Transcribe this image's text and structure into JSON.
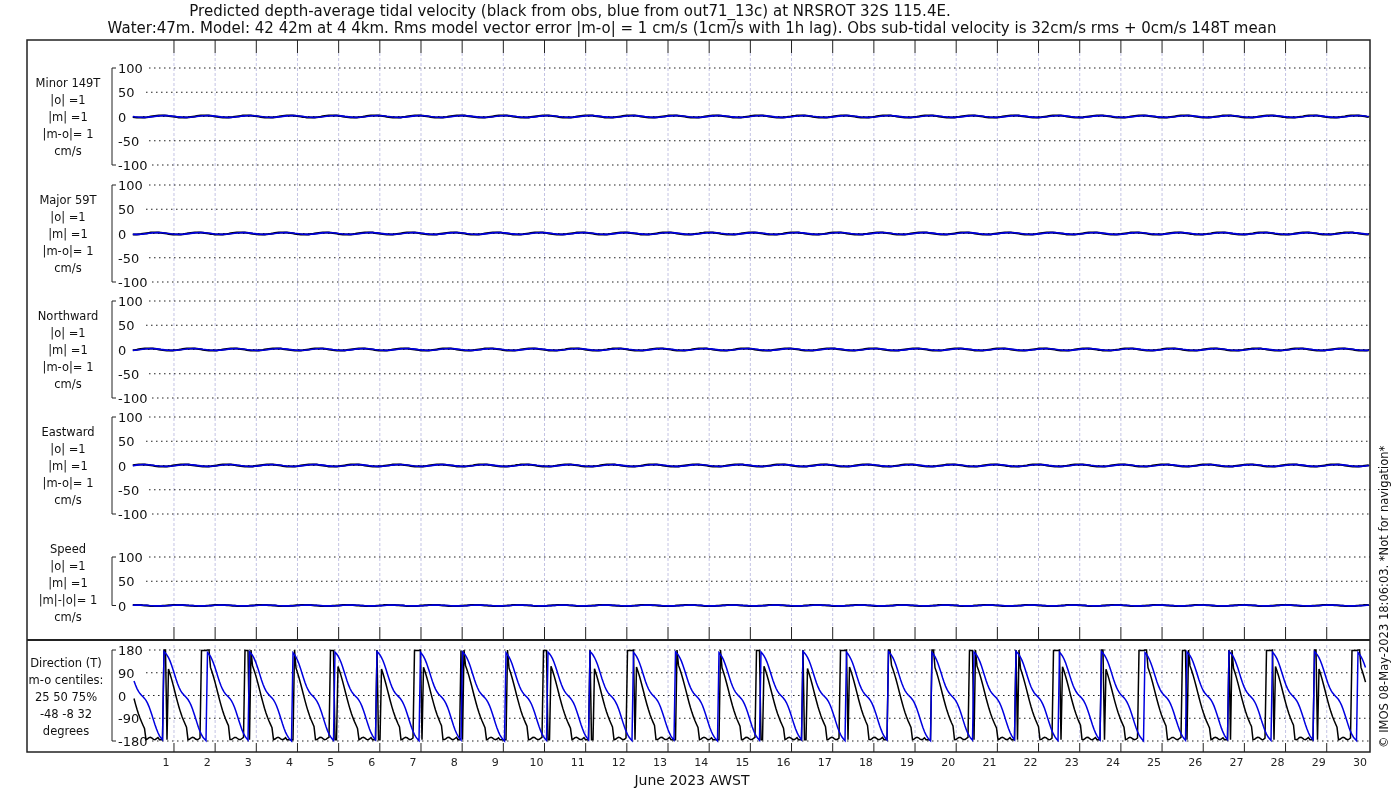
{
  "title": "Predicted depth-average tidal velocity (black from obs, blue from out71_13c) at NRSROT 32S 115.4E.",
  "subtitle": "Water:47m. Model: 42 42m at 4 4km. Rms model vector error |m-o| = 1 cm/s (1cm/s with 1h lag). Obs sub-tidal velocity is 32cm/s rms + 0cm/s 148T mean",
  "panels": [
    {
      "label_lines": [
        "Minor 149T",
        "|o| =1",
        "|m| =1",
        "|m-o|= 1",
        "cm/s"
      ],
      "yticks": [
        "100",
        "50",
        "0",
        "-50",
        "-100"
      ]
    },
    {
      "label_lines": [
        "Major 59T",
        "|o| =1",
        "|m| =1",
        "|m-o|= 1",
        "cm/s"
      ],
      "yticks": [
        "100",
        "50",
        "0",
        "-50",
        "-100"
      ]
    },
    {
      "label_lines": [
        "Northward",
        "|o| =1",
        "|m| =1",
        "|m-o|= 1",
        "cm/s"
      ],
      "yticks": [
        "100",
        "50",
        "0",
        "-50",
        "-100"
      ]
    },
    {
      "label_lines": [
        "Eastward",
        "|o| =1",
        "|m| =1",
        "|m-o|= 1",
        "cm/s"
      ],
      "yticks": [
        "100",
        "50",
        "0",
        "-50",
        "-100"
      ]
    },
    {
      "label_lines": [
        "Speed",
        "|o| =1",
        "|m| =1",
        "|m|-|o|= 1",
        "cm/s"
      ],
      "yticks": [
        "100",
        "50",
        "0"
      ]
    }
  ],
  "direction": {
    "label_lines": [
      "Direction (T)",
      "m-o centiles:",
      "25  50  75%",
      "-48  -8  32",
      "degrees"
    ],
    "yticks": [
      "180",
      "90",
      "0",
      "-90",
      "-180"
    ]
  },
  "days": [
    "1",
    "2",
    "3",
    "4",
    "5",
    "6",
    "7",
    "8",
    "9",
    "10",
    "11",
    "12",
    "13",
    "14",
    "15",
    "16",
    "17",
    "18",
    "19",
    "20",
    "21",
    "22",
    "23",
    "24",
    "25",
    "26",
    "27",
    "28",
    "29",
    "30"
  ],
  "xlabel": "June 2023 AWST",
  "credit": "© IMOS 08-May-2023 18:06:03. *Not for navigation*"
}
